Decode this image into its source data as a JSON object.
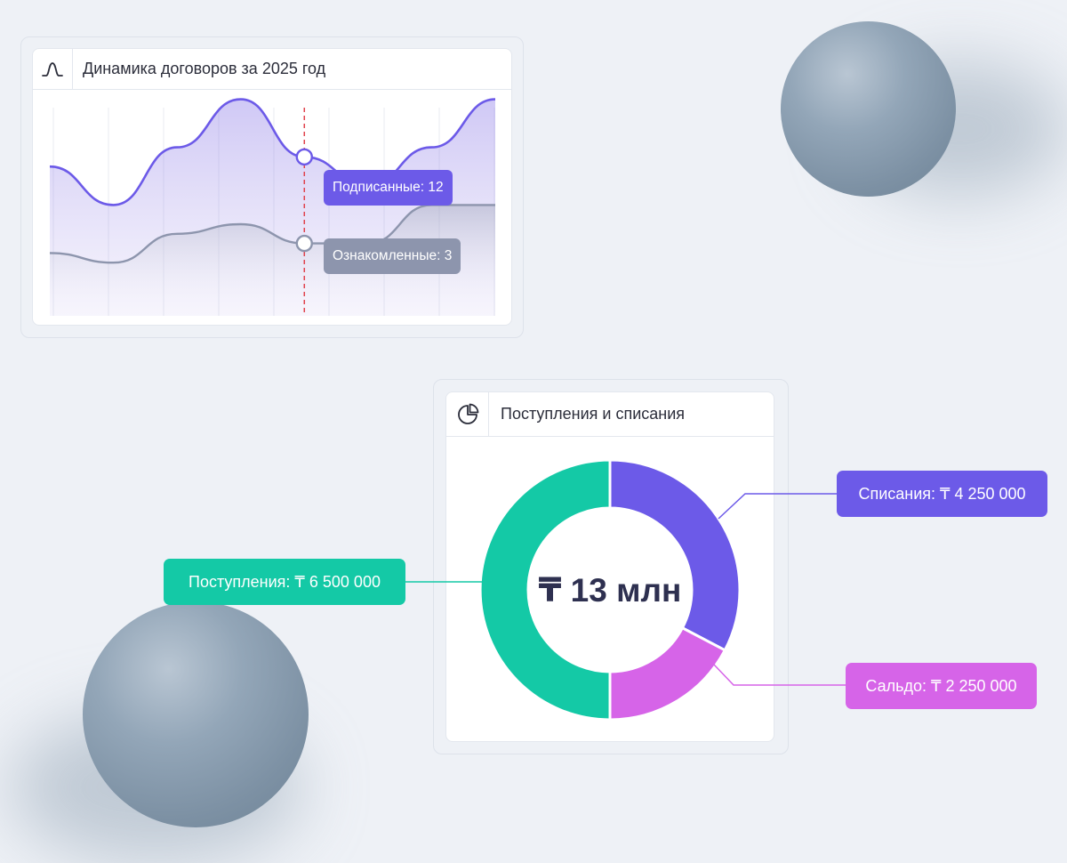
{
  "line_card": {
    "title": "Динамика договоров за 2025 год",
    "icon": "bell-curve-icon",
    "tooltip_signed": "Подписанные: 12",
    "tooltip_viewed": "Ознакомленные: 3"
  },
  "donut_card": {
    "title": "Поступления и списания",
    "icon": "pie-chart-icon",
    "center_label": "₸ 13 млн"
  },
  "callouts": {
    "writeoffs": "Списания: ₸ 4 250 000",
    "income": "Поступления: ₸ 6 500 000",
    "balance": "Сальдо: ₸ 2 250 000"
  },
  "colors": {
    "purple": "#6c5ae8",
    "gray": "#8d95ad",
    "teal": "#14c9a6",
    "magenta": "#d664e8",
    "marker_red": "#e0404a"
  },
  "chart_data": [
    {
      "type": "area",
      "title": "Динамика договоров за 2025 год",
      "series": [
        {
          "name": "Подписанные",
          "values": [
            11,
            7,
            13,
            18,
            12,
            9,
            13,
            18
          ],
          "annotation": 12
        },
        {
          "name": "Ознакомленные",
          "values": [
            2,
            1,
            4,
            5,
            3,
            3,
            7,
            7
          ],
          "annotation": 3
        }
      ],
      "grid": true,
      "marker_index": 4
    },
    {
      "type": "pie",
      "title": "Поступления и списания",
      "center": "₸ 13 млн",
      "categories": [
        "Списания",
        "Сальдо",
        "Поступления"
      ],
      "values": [
        4250000,
        2250000,
        6500000
      ]
    }
  ]
}
